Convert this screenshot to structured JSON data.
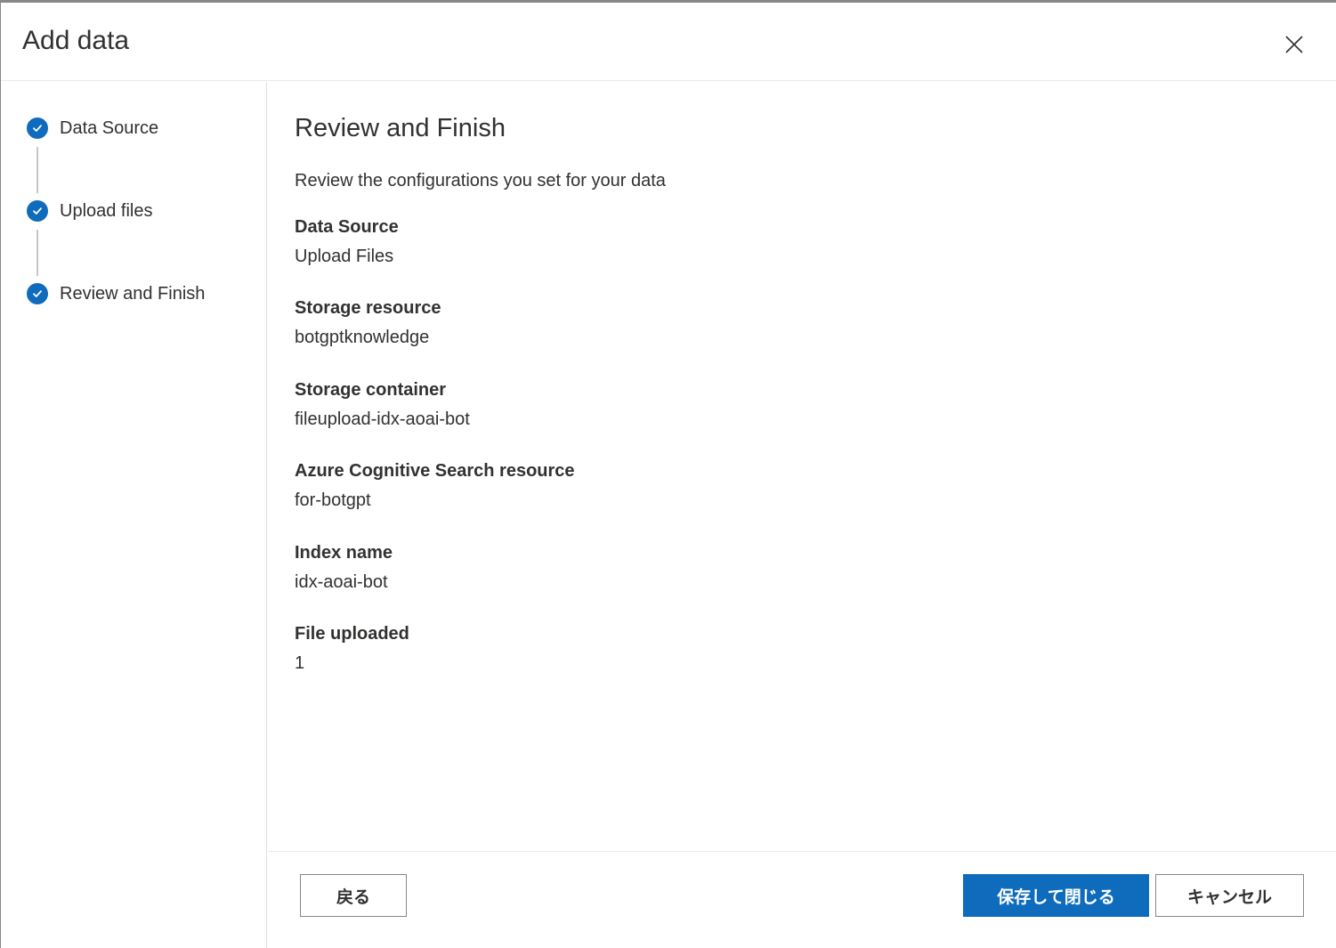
{
  "dialog": {
    "title": "Add data"
  },
  "steps": [
    {
      "label": "Data Source",
      "status": "completed"
    },
    {
      "label": "Upload files",
      "status": "completed"
    },
    {
      "label": "Review and Finish",
      "status": "completed"
    }
  ],
  "main": {
    "title": "Review and Finish",
    "description": "Review the configurations you set for your data",
    "fields": [
      {
        "label": "Data Source",
        "value": "Upload Files"
      },
      {
        "label": "Storage resource",
        "value": "botgptknowledge"
      },
      {
        "label": "Storage container",
        "value": "fileupload-idx-aoai-bot"
      },
      {
        "label": "Azure Cognitive Search resource",
        "value": "for-botgpt"
      },
      {
        "label": "Index name",
        "value": "idx-aoai-bot"
      },
      {
        "label": "File uploaded",
        "value": "1"
      }
    ]
  },
  "footer": {
    "back_label": "戻る",
    "save_label": "保存して閉じる",
    "cancel_label": "キャンセル"
  },
  "colors": {
    "accent": "#0f6cbd",
    "text": "#323130",
    "divider": "#edebe9"
  },
  "icons": {
    "close": "close-icon",
    "step_check": "checkmark-circle-icon"
  }
}
